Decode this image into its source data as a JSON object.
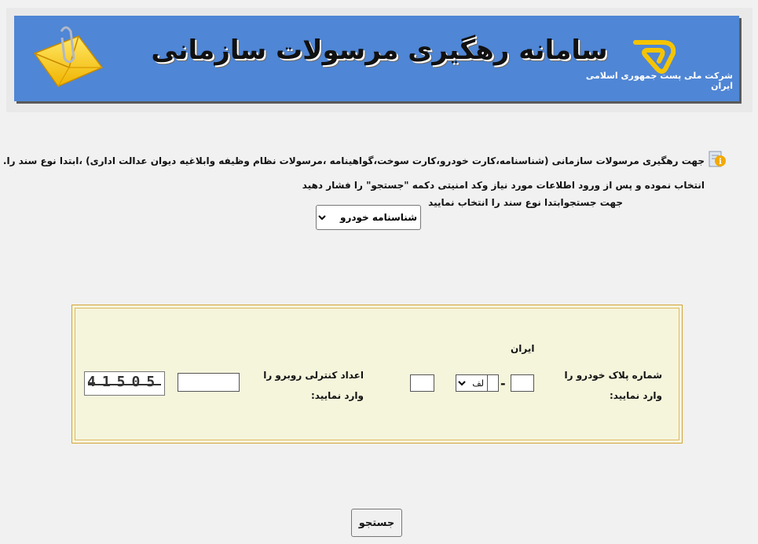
{
  "header": {
    "title": "سامانه رهگیری مرسولات سازمانی",
    "company_name": "شرکت ملی پست جمهوری اسلامی ایران"
  },
  "intro": {
    "line1": "جهت رهگیری مرسولات سازمانی (شناسنامه،کارت خودرو،کارت سوخت،گواهینامه ،مرسولات نظام وظیفه  وابلاغیه دیوان عدالت اداری) ،ابتدا  نوع سند را.",
    "line2": "انتخاب نموده و پس از ورود اطلاعات مورد نیاز وکد امنیتی دکمه \"جستجو\" را فشار دهید",
    "line3": "جهت جستجوابتدا نوع سند را انتخاب نمایید"
  },
  "doc_type": {
    "selected": "شناسنامه خودرو"
  },
  "form": {
    "plate_label": "شماره پلاک خودرو را وارد نمایید:",
    "iran_label": "ایران",
    "plate_letter": "لف",
    "plate_dash": "-",
    "captcha_label": "اعداد کنترلی روبرو را وارد نمایید:",
    "captcha_code": "41505"
  },
  "search_button": {
    "label": "جستجو"
  },
  "colors": {
    "banner": "#4f86d5",
    "panel": "#f5f5dc",
    "panel_border": "#d4a437"
  }
}
